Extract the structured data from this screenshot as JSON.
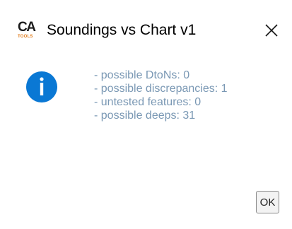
{
  "window": {
    "title": "Soundings vs Chart v1",
    "logo": {
      "primary": "CA",
      "secondary": "TOOLS"
    },
    "close_icon": "close-icon"
  },
  "message": {
    "icon": "info-icon",
    "lines": [
      "- possible DtoNs: 0",
      "- possible discrepancies: 1",
      "- untested features: 0",
      "- possible deeps: 31"
    ]
  },
  "buttons": {
    "ok_label": "OK"
  },
  "colors": {
    "info_icon_fill": "#0a78d4",
    "message_text": "#7a98b4",
    "logo_accent": "#e07b1a"
  }
}
